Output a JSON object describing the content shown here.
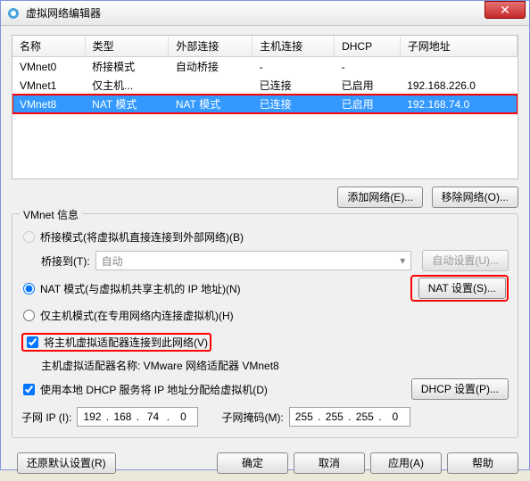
{
  "window": {
    "title": "虚拟网络编辑器"
  },
  "table": {
    "headers": [
      "名称",
      "类型",
      "外部连接",
      "主机连接",
      "DHCP",
      "子网地址"
    ],
    "rows": [
      {
        "name": "VMnet0",
        "type": "桥接模式",
        "ext": "自动桥接",
        "host": "-",
        "dhcp": "-",
        "subnet": ""
      },
      {
        "name": "VMnet1",
        "type": "仅主机...",
        "ext": "",
        "host": "已连接",
        "dhcp": "已启用",
        "subnet": "192.168.226.0"
      },
      {
        "name": "VMnet8",
        "type": "NAT 模式",
        "ext": "NAT 模式",
        "host": "已连接",
        "dhcp": "已启用",
        "subnet": "192.168.74.0"
      }
    ]
  },
  "buttons": {
    "add_net": "添加网络(E)...",
    "remove_net": "移除网络(O)...",
    "auto_set": "自动设置(U)...",
    "nat_set": "NAT 设置(S)...",
    "dhcp_set": "DHCP 设置(P)...",
    "restore": "还原默认设置(R)",
    "ok": "确定",
    "cancel": "取消",
    "apply": "应用(A)",
    "help": "帮助"
  },
  "group": {
    "legend": "VMnet 信息",
    "bridge_label": "桥接模式(将虚拟机直接连接到外部网络)(B)",
    "bridge_to": "桥接到(T):",
    "bridge_value": "自动",
    "nat_label": "NAT 模式(与虚拟机共享主机的 IP 地址)(N)",
    "hostonly_label": "仅主机模式(在专用网络内连接虚拟机)(H)",
    "connect_host": "将主机虚拟适配器连接到此网络(V)",
    "adapter_name_label": "主机虚拟适配器名称: VMware 网络适配器 VMnet8",
    "use_dhcp": "使用本地 DHCP 服务将 IP 地址分配给虚拟机(D)",
    "subnet_ip_label": "子网 IP (I):",
    "subnet_ip": [
      "192",
      "168",
      "74",
      "0"
    ],
    "mask_label": "子网掩码(M):",
    "mask": [
      "255",
      "255",
      "255",
      "0"
    ]
  }
}
